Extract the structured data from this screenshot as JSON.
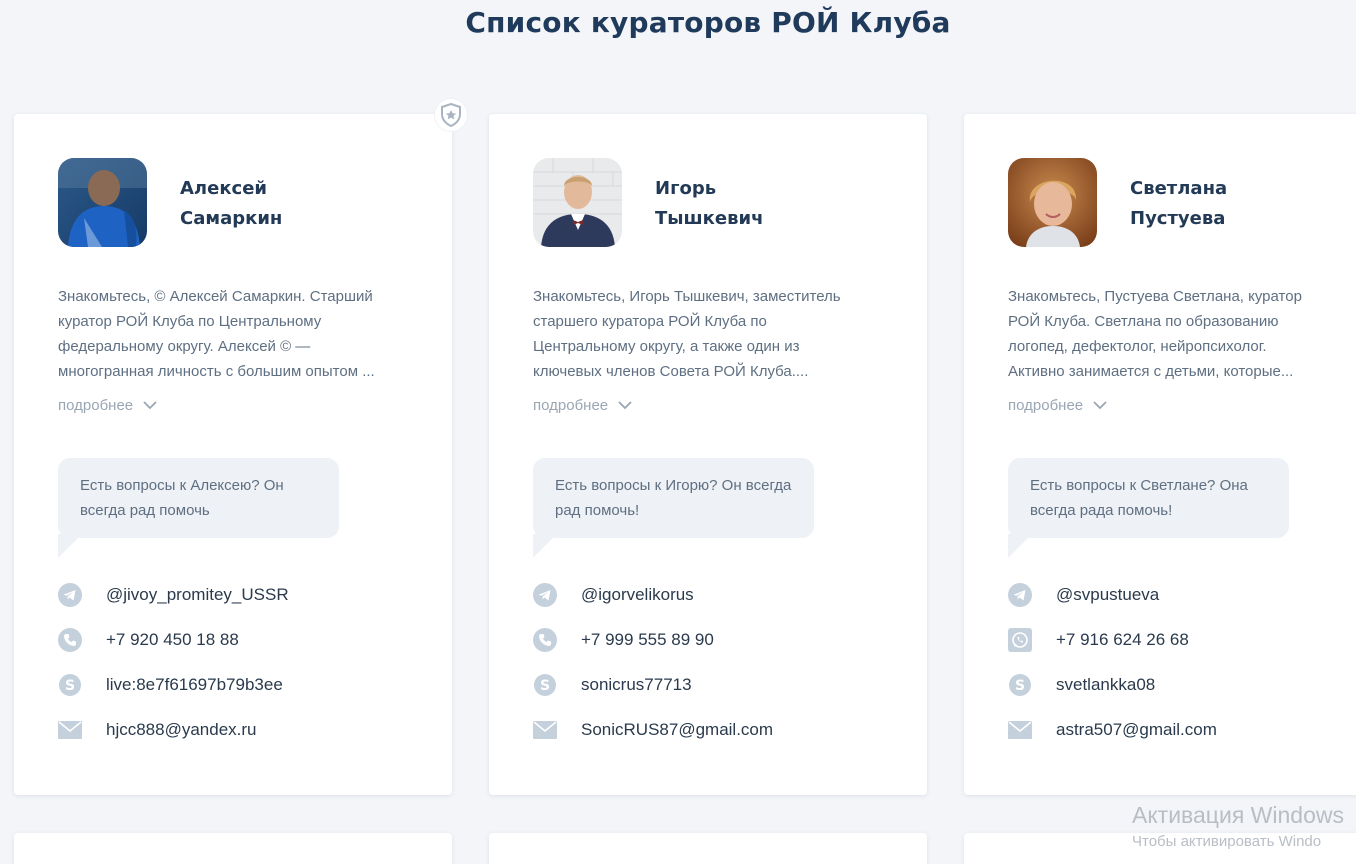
{
  "page": {
    "title": "Список кураторов РОЙ Клуба"
  },
  "colors": {
    "icon": "#c4d0dc",
    "accent": "#1f3a5a",
    "muted": "#9aa6b4"
  },
  "curators": [
    {
      "first_name": "Алексей",
      "last_name": "Самаркин",
      "desc_lines": [
        "Знакомьтесь, © Алексей Самаркин. Старший",
        "куратор РОЙ Клуба по Центральному",
        "федеральному округу. Алексей © —",
        "многогранная личность с большим опытом ..."
      ],
      "more_label": "подробнее",
      "bubble": "Есть вопросы к Алексею? Он всегда рад помочь",
      "telegram": "@jivoy_promitey_USSR",
      "phone": "+7 920 450 18 88",
      "phone_icon": "phone-icon",
      "skype": "live:8e7f61697b79b3ee",
      "email": "hjcc888@yandex.ru"
    },
    {
      "first_name": "Игорь",
      "last_name": "Тышкевич",
      "desc_lines": [
        "Знакомьтесь, Игорь Тышкевич, заместитель",
        "старшего куратора РОЙ Клуба по",
        "Центральному округу, а также один из",
        "ключевых членов Совета РОЙ Клуба...."
      ],
      "more_label": "подробнее",
      "bubble": "Есть вопросы к Игорю? Он всегда рад помочь!",
      "telegram": "@igorvelikorus",
      "phone": "+7 999 555 89 90",
      "phone_icon": "phone-icon",
      "skype": "sonicrus77713",
      "email": "SonicRUS87@gmail.com"
    },
    {
      "first_name": "Светлана",
      "last_name": "Пустуева",
      "desc_lines": [
        "Знакомьтесь, Пустуева Светлана, куратор",
        "РОЙ Клуба. Светлана по образованию",
        "логопед, дефектолог, нейропсихолог.",
        "Активно занимается с детьми, которые..."
      ],
      "more_label": "подробнее",
      "bubble": "Есть вопросы к Светлане? Она всегда рада помочь!",
      "telegram": "@svpustueva",
      "phone": "+7 916 624 26 68",
      "phone_icon": "whatsapp-icon",
      "skype": "svetlankka08",
      "email": "astra507@gmail.com"
    }
  ],
  "watermark": {
    "line1": "Активация Windows",
    "line2": "Чтобы активировать Windo"
  }
}
